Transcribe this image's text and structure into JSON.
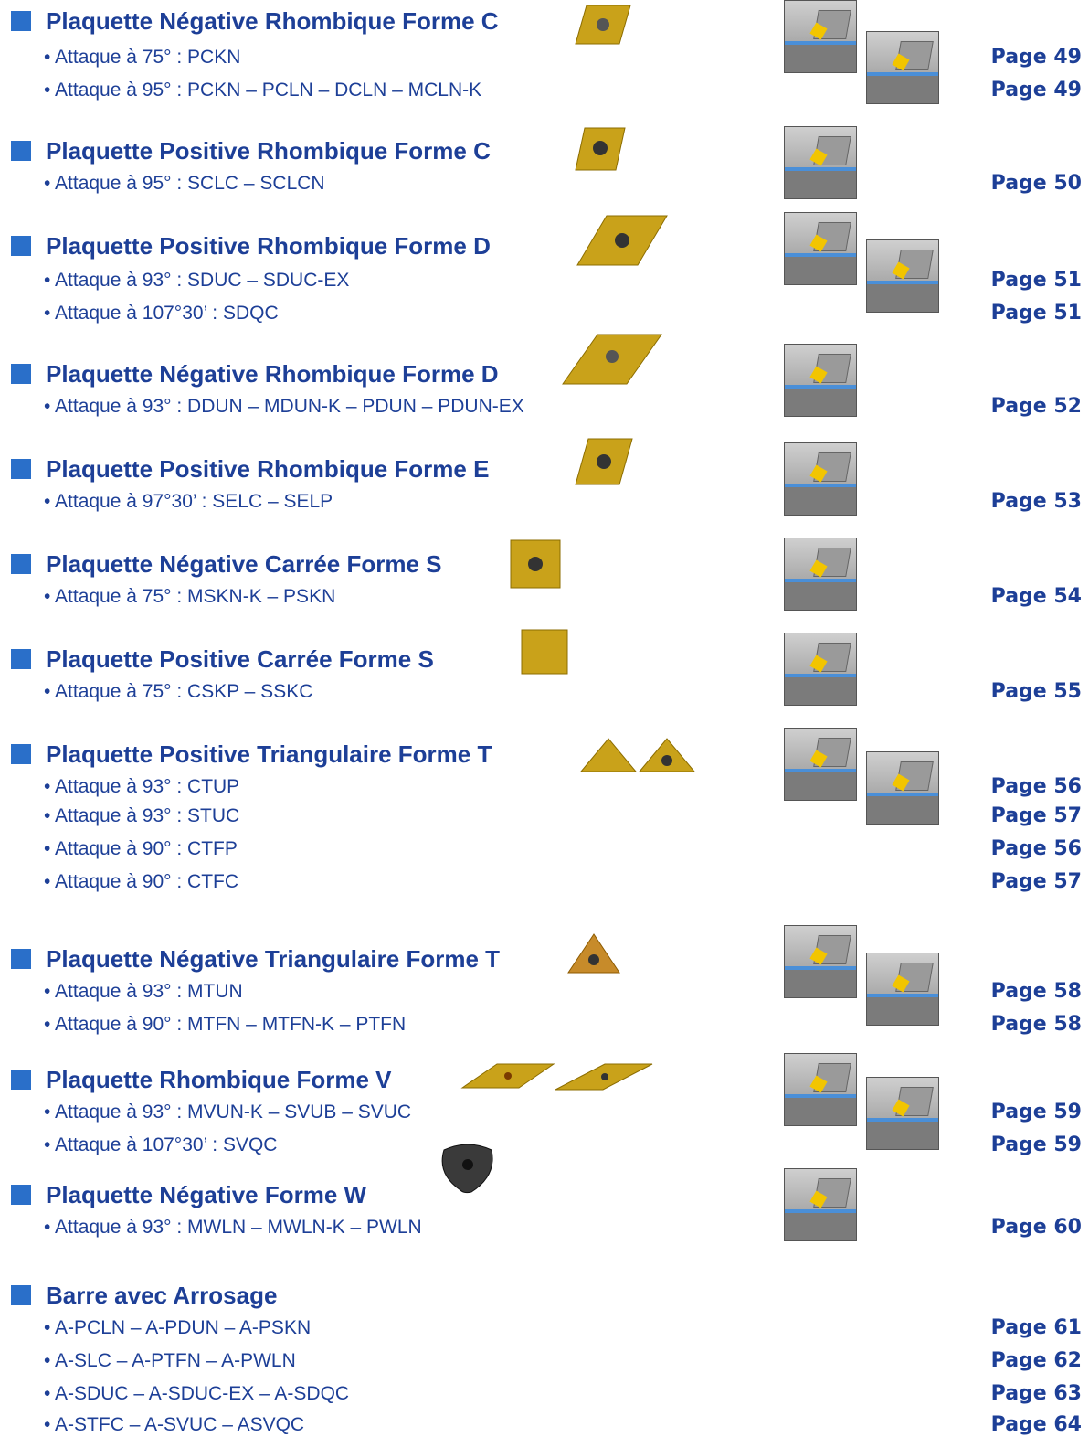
{
  "sections": [
    {
      "title": "Plaquette Négative Rhombique Forme C",
      "lines": [
        "• Attaque à 75° : PCKN",
        "• Attaque à 95° : PCKN – PCLN – DCLN – MCLN-K"
      ],
      "pages": [
        "Page 49",
        "Page 49"
      ],
      "diagrams": 2
    },
    {
      "title": "Plaquette Positive Rhombique Forme C",
      "lines": [
        "• Attaque à 95° : SCLC – SCLCN"
      ],
      "pages": [
        "Page 50"
      ],
      "diagrams": 1
    },
    {
      "title": "Plaquette Positive Rhombique Forme D",
      "lines": [
        "• Attaque à 93° : SDUC – SDUC-EX",
        "• Attaque à 107°30’ :  SDQC"
      ],
      "pages": [
        "Page 51",
        "Page 51"
      ],
      "diagrams": 2
    },
    {
      "title": "Plaquette Négative Rhombique Forme D",
      "lines": [
        "• Attaque à 93° : DDUN – MDUN-K – PDUN – PDUN-EX"
      ],
      "pages": [
        "Page 52"
      ],
      "diagrams": 1
    },
    {
      "title": "Plaquette Positive Rhombique Forme E",
      "lines": [
        "• Attaque à 97°30’ : SELC – SELP"
      ],
      "pages": [
        "Page 53"
      ],
      "diagrams": 1
    },
    {
      "title": "Plaquette Négative Carrée Forme S",
      "lines": [
        "• Attaque à 75° : MSKN-K – PSKN"
      ],
      "pages": [
        "Page 54"
      ],
      "diagrams": 1
    },
    {
      "title": "Plaquette Positive Carrée Forme S",
      "lines": [
        "• Attaque à 75° : CSKP – SSKC"
      ],
      "pages": [
        "Page 55"
      ],
      "diagrams": 1
    },
    {
      "title": "Plaquette Positive Triangulaire Forme T",
      "lines": [
        "• Attaque à 93° : CTUP",
        "• Attaque à 93° : STUC",
        "• Attaque à 90° : CTFP",
        "• Attaque à 90° : CTFC"
      ],
      "pages": [
        "Page 56",
        "Page 57",
        "Page 56",
        "Page 57"
      ],
      "diagrams": 2
    },
    {
      "title": "Plaquette Négative Triangulaire Forme T",
      "lines": [
        "• Attaque à 93° : MTUN",
        "• Attaque à 90° : MTFN – MTFN-K – PTFN"
      ],
      "pages": [
        "Page 58",
        "Page 58"
      ],
      "diagrams": 2
    },
    {
      "title": "Plaquette Rhombique Forme V",
      "lines": [
        "• Attaque à 93° : MVUN-K – SVUB – SVUC",
        "• Attaque à 107°30’ :  SVQC"
      ],
      "pages": [
        "Page 59",
        "Page 59"
      ],
      "diagrams": 2
    },
    {
      "title": "Plaquette Négative Forme W",
      "lines": [
        "• Attaque à 93° : MWLN – MWLN-K – PWLN"
      ],
      "pages": [
        "Page 60"
      ],
      "diagrams": 1
    },
    {
      "title": "Barre avec Arrosage",
      "lines": [
        "• A-PCLN – A-PDUN – A-PSKN",
        "• A-SLC – A-PTFN – A-PWLN",
        "• A-SDUC – A-SDUC-EX – A-SDQC",
        "• A-STFC – A-SVUC – ASVQC"
      ],
      "pages": [
        "Page 61",
        "Page 62",
        "Page 63",
        "Page 64"
      ],
      "diagrams": 0
    }
  ],
  "colors": {
    "title": "#1d3f97",
    "bullet": "#2a6fc9",
    "insert_gold": "#c9a21a",
    "insert_black": "#333333"
  }
}
